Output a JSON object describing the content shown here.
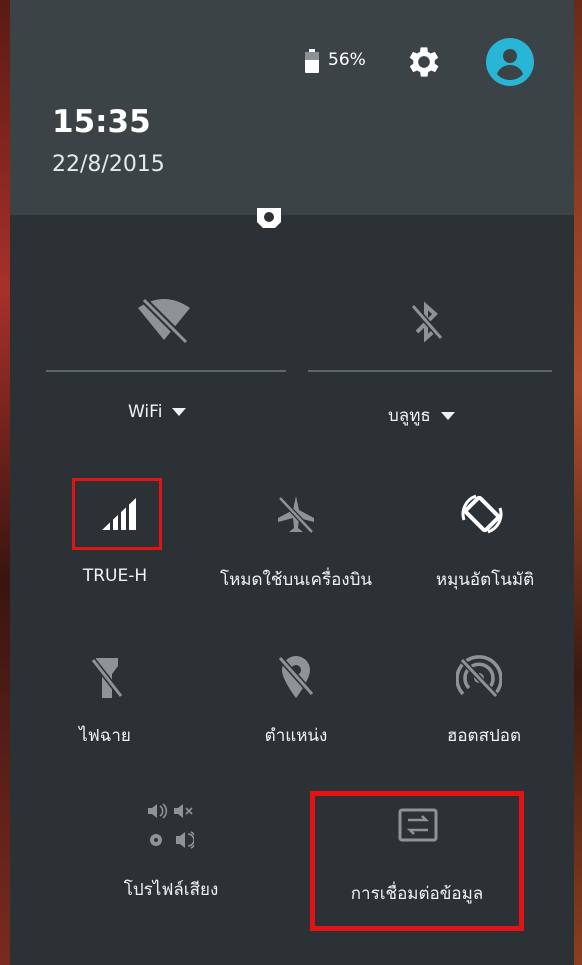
{
  "status_bar": {
    "battery_percent": "56%",
    "battery_level": 0.56
  },
  "header": {
    "time": "15:35",
    "date": "22/8/2015"
  },
  "toggles": {
    "wifi": {
      "label": "WiFi",
      "state": "disabled"
    },
    "bluetooth": {
      "label": "บลูทูธ",
      "state": "disabled"
    }
  },
  "tiles": [
    {
      "id": "mobile-data",
      "label": "TRUE-H",
      "icon": "signal-icon",
      "highlighted": true
    },
    {
      "id": "airplane",
      "label": "โหมดใช้บนเครื่องบิน",
      "icon": "airplane-icon"
    },
    {
      "id": "auto-rotate",
      "label": "หมุนอัตโนมัติ",
      "icon": "rotate-icon"
    },
    {
      "id": "flashlight",
      "label": "ไฟฉาย",
      "icon": "flashlight-off-icon"
    },
    {
      "id": "location",
      "label": "ตำแหน่ง",
      "icon": "location-off-icon"
    },
    {
      "id": "hotspot",
      "label": "ฮอตสปอต",
      "icon": "hotspot-off-icon"
    },
    {
      "id": "sound-profile",
      "label": "โปรไฟล์เสียง",
      "icon": "sound-profile-icon"
    },
    {
      "id": "data-connection",
      "label": "การเชื่อมต่อข้อมูล",
      "icon": "data-transfer-icon",
      "highlighted": true
    }
  ],
  "colors": {
    "highlight": "#e01414",
    "accent": "#29b6d6",
    "panel": "#2b3135",
    "header": "#3c4347"
  }
}
